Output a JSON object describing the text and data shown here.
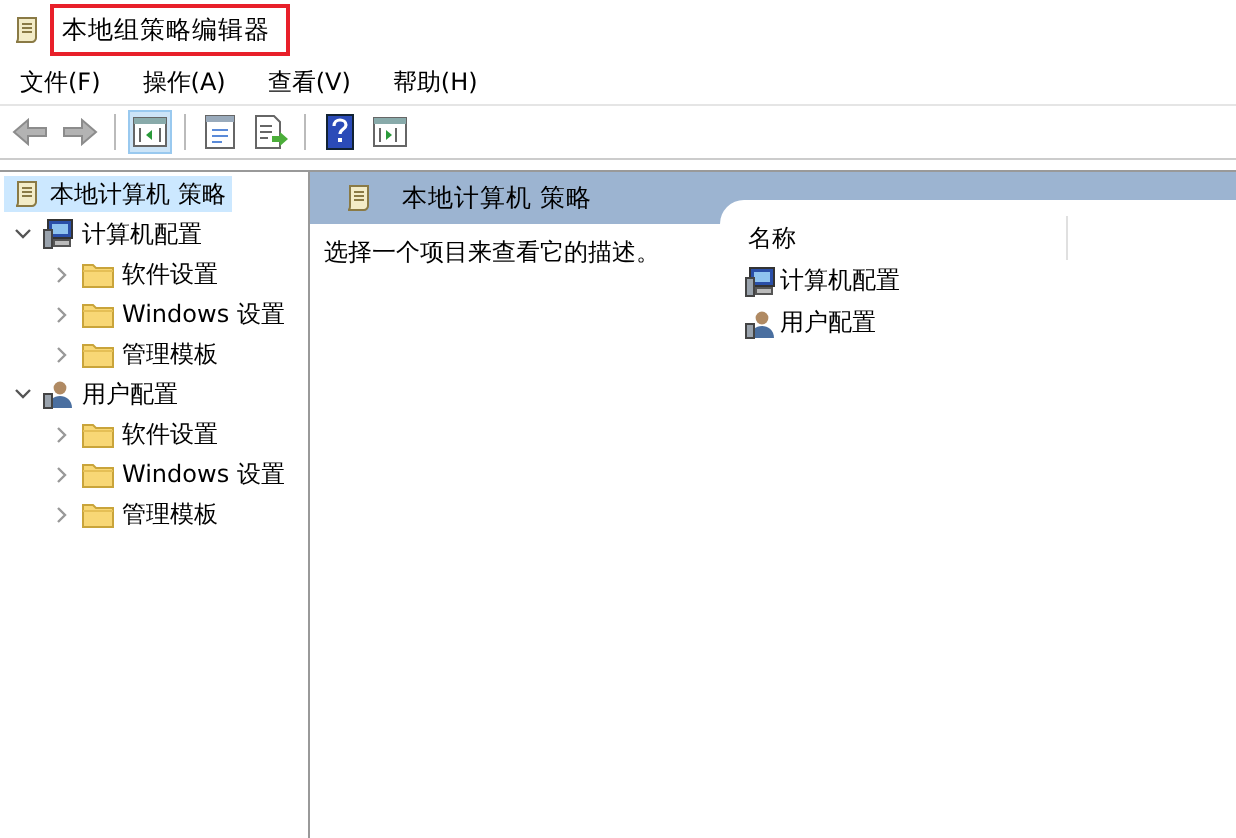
{
  "window": {
    "title": "本地组策略编辑器",
    "highlighted": true
  },
  "menu": [
    "文件(F)",
    "操作(A)",
    "查看(V)",
    "帮助(H)"
  ],
  "toolbar": [
    {
      "kind": "back",
      "disabled": true,
      "selected": false
    },
    {
      "kind": "forward",
      "disabled": true,
      "selected": false
    },
    {
      "kind": "tree",
      "disabled": false,
      "selected": true
    },
    {
      "kind": "properties",
      "disabled": false,
      "selected": false
    },
    {
      "kind": "export",
      "disabled": false,
      "selected": false
    },
    {
      "kind": "help",
      "disabled": false,
      "selected": false
    },
    {
      "kind": "action",
      "disabled": false,
      "selected": false
    }
  ],
  "tree": [
    {
      "label": "本地计算机 策略",
      "kind": "scroll",
      "selected": true,
      "children": [
        {
          "label": "计算机配置",
          "kind": "computer",
          "selected": false,
          "expanded": true,
          "children": [
            {
              "label": "软件设置",
              "kind": "folder",
              "selected": false,
              "expanded": false
            },
            {
              "label": "Windows 设置",
              "kind": "folder",
              "selected": false,
              "expanded": false
            },
            {
              "label": "管理模板",
              "kind": "folder",
              "selected": false,
              "expanded": false
            }
          ]
        },
        {
          "label": "用户配置",
          "kind": "user",
          "selected": false,
          "expanded": true,
          "children": [
            {
              "label": "软件设置",
              "kind": "folder",
              "selected": false,
              "expanded": false
            },
            {
              "label": "Windows 设置",
              "kind": "folder",
              "selected": false,
              "expanded": false
            },
            {
              "label": "管理模板",
              "kind": "folder",
              "selected": false,
              "expanded": false
            }
          ]
        }
      ]
    }
  ],
  "details": {
    "header": "本地计算机 策略",
    "description": "选择一个项目来查看它的描述。",
    "columns": [
      "名称"
    ],
    "items": [
      {
        "label": "计算机配置",
        "kind": "computer"
      },
      {
        "label": "用户配置",
        "kind": "user"
      }
    ]
  }
}
